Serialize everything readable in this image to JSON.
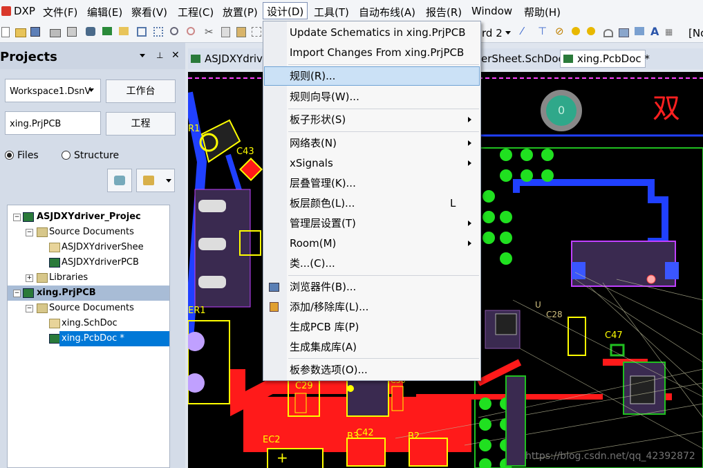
{
  "menubar": {
    "items": [
      "DXP",
      "文件(F)",
      "编辑(E)",
      "察看(V)",
      "工程(C)",
      "放置(P)",
      "设计(D)",
      "工具(T)",
      "自动布线(A)",
      "报告(R)",
      "Window",
      "帮助(H)"
    ]
  },
  "toolbar": {
    "combo_fragment": "rd 2",
    "right_fragment": "[No"
  },
  "projects_panel": {
    "title": "Projects",
    "workspace_value": "Workspace1.DsnV",
    "workspace_button": "工作台",
    "project_value": "xing.PrjPCB",
    "project_button": "工程",
    "radio_files": "Files",
    "radio_structure": "Structure",
    "tree": [
      "ASJDXYdriver_Projec",
      "Source Documents",
      "ASJDXYdriverShee",
      "ASJDXYdriverPCB",
      "Libraries",
      "xing.PrjPCB",
      "Source Documents",
      "xing.SchDoc",
      "xing.PcbDoc *"
    ]
  },
  "tabs": {
    "tab1": "ASJDXYdriv",
    "tab2": "erSheet.SchDoc",
    "tab3": "xing.PcbDoc *"
  },
  "design_menu": {
    "items": [
      "Update Schematics in xing.PrjPCB",
      "Import Changes From xing.PrjPCB",
      "规则(R)...",
      "规则向导(W)...",
      "板子形状(S)",
      "网络表(N)",
      "xSignals",
      "层叠管理(K)...",
      "板层颜色(L)...",
      "管理层设置(T)",
      "Room(M)",
      "类...(C)...",
      "浏览器件(B)...",
      "添加/移除库(L)...",
      "生成PCB 库(P)",
      "生成集成库(A)",
      "板参数选项(O)..."
    ],
    "shortcut_layer_color": "L"
  },
  "pcb": {
    "labels": [
      "R1",
      "C43",
      "ER1",
      "C29",
      "C30",
      "EC2",
      "B3",
      "C42",
      "B2",
      "C47",
      "C28",
      "U",
      "0",
      "双"
    ],
    "watermark": "https://blog.csdn.net/qq_42392872"
  },
  "colors": {
    "highlight": "#cbe1f6",
    "trace_red": "#ff1a1a",
    "trace_blue": "#2040ff",
    "silkscreen": "#ffff00",
    "selected": "#0078d7"
  }
}
